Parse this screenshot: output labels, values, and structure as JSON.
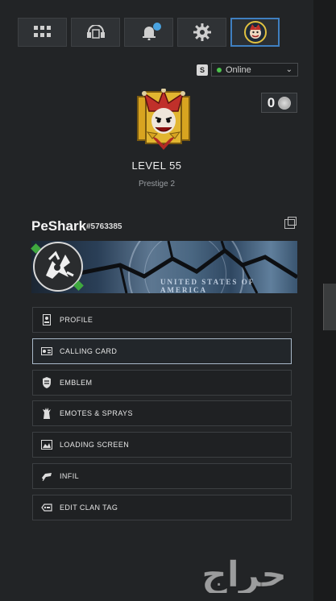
{
  "tabs": [
    {
      "id": "menu",
      "icon": "grid-icon"
    },
    {
      "id": "social",
      "icon": "headset-icon"
    },
    {
      "id": "notifications",
      "icon": "bell-icon"
    },
    {
      "id": "settings",
      "icon": "gear-icon"
    },
    {
      "id": "profile",
      "icon": "player-emblem-icon",
      "active": true
    }
  ],
  "status": {
    "key_hint": "S",
    "value": "Online"
  },
  "currency": {
    "amount": "0",
    "icon": "coin-icon"
  },
  "rank": {
    "level": "LEVEL 55",
    "prestige": "Prestige 2",
    "icon": "jester-rank-icon"
  },
  "player": {
    "name": "PeShark",
    "id": "#5763385"
  },
  "calling_card": {
    "caption": "UNITED STATES OF AMERICA"
  },
  "menu": [
    {
      "label": "PROFILE",
      "icon": "profile-card-icon"
    },
    {
      "label": "CALLING CARD",
      "icon": "calling-card-icon",
      "selected": true
    },
    {
      "label": "EMBLEM",
      "icon": "emblem-icon"
    },
    {
      "label": "EMOTES & SPRAYS",
      "icon": "emote-icon"
    },
    {
      "label": "LOADING SCREEN",
      "icon": "loading-screen-icon"
    },
    {
      "label": "INFIL",
      "icon": "infil-icon"
    },
    {
      "label": "EDIT CLAN TAG",
      "icon": "clan-tag-icon"
    }
  ],
  "watermark": {
    "text": "حراج"
  },
  "colors": {
    "accent": "#3f7fc0",
    "online": "#4cc24c",
    "panel": "#222426"
  }
}
